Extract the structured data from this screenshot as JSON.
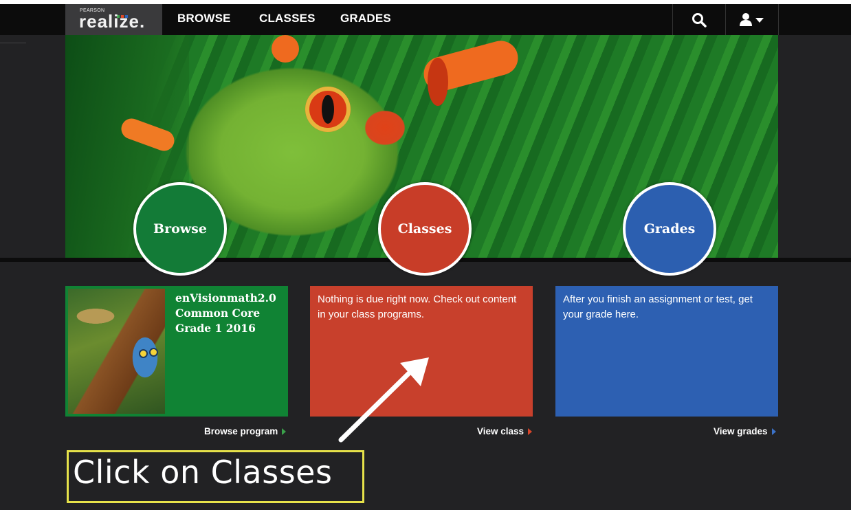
{
  "app": {
    "brand_small": "PEARSON",
    "brand": "realize.",
    "brand_dot_colors": [
      "#3aa14a",
      "#e04a2a",
      "#2c63b8"
    ]
  },
  "nav": {
    "items": [
      {
        "label": "BROWSE"
      },
      {
        "label": "CLASSES"
      },
      {
        "label": "GRADES"
      }
    ],
    "search_icon": "search-icon",
    "user_icon": "user-menu-icon"
  },
  "hero": {
    "image": "tree-frog-banner",
    "circles": {
      "browse": "Browse",
      "classes": "Classes",
      "grades": "Grades"
    }
  },
  "cards": {
    "browse": {
      "title_line1": "enVisionmath2.0",
      "title_line2": "Common Core",
      "title_line3": "Grade 1 2016",
      "link": "Browse program",
      "color": "#108334"
    },
    "classes": {
      "text": "Nothing is due right now. Check out content in your class programs.",
      "link": "View class",
      "color": "#c8402c"
    },
    "grades": {
      "text": "After you finish an assignment or test, get your grade here.",
      "link": "View grades",
      "color": "#2d60b2"
    }
  },
  "annotation": {
    "text": "Click on Classes",
    "box_color": "#e6e24a"
  }
}
